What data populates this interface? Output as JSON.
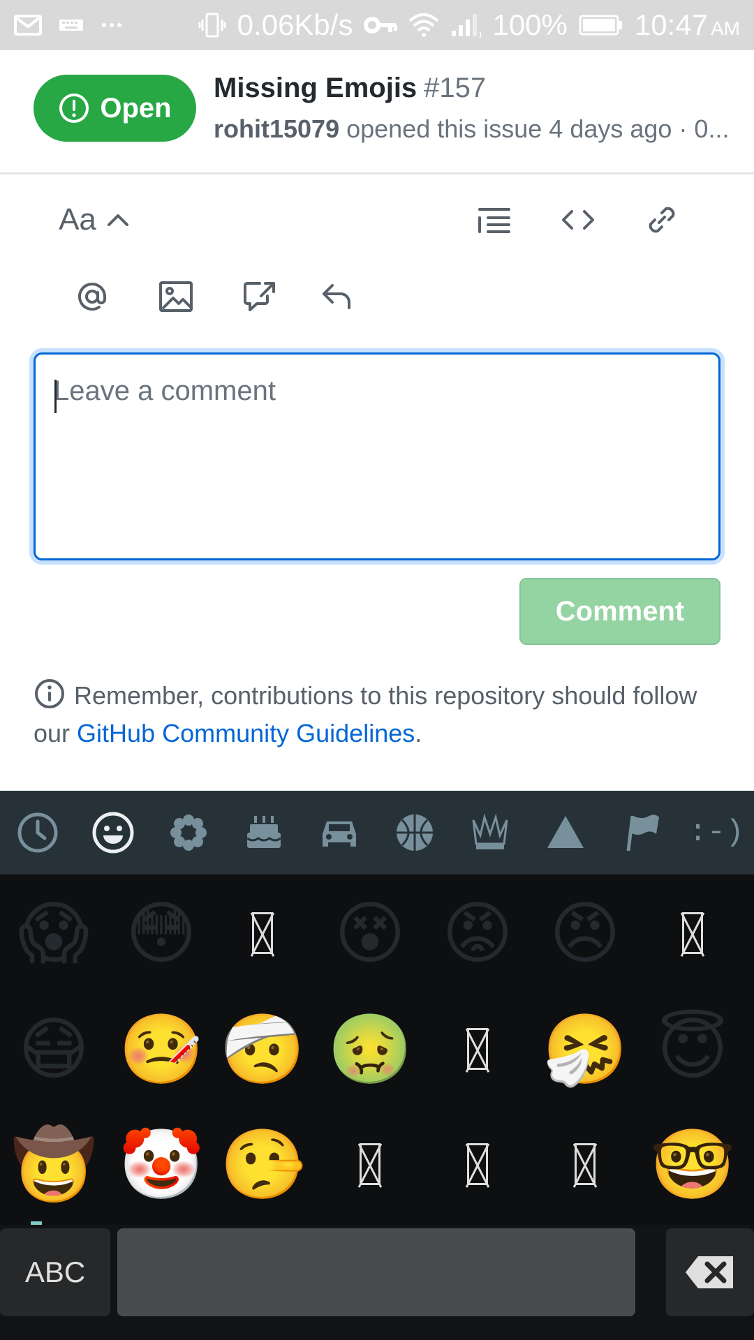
{
  "status_bar": {
    "network_speed": "0.06Kb/s",
    "battery": "100%",
    "time": "10:47",
    "ampm": "AM",
    "signal_sub": "1",
    "icons": [
      "gmail-icon",
      "keyboard-icon",
      "more-icon",
      "vibrate-icon",
      "vpn-key-icon",
      "wifi-icon",
      "signal-icon",
      "battery-icon"
    ]
  },
  "issue": {
    "state_label": "Open",
    "title": "Missing Emojis",
    "number": "#157",
    "author": "rohit15079",
    "meta_rest": " opened this issue 4 days ago · 0..."
  },
  "toolbar": {
    "text_style_label": "Aa",
    "icons_row1": [
      "chevron-up-icon",
      "list-icon",
      "code-icon",
      "link-icon"
    ],
    "icons_row2": [
      "mention-icon",
      "image-icon",
      "reference-icon",
      "reply-icon"
    ]
  },
  "comment": {
    "placeholder": "Leave a comment",
    "value": "",
    "button_label": "Comment"
  },
  "guidelines": {
    "text": "Remember, contributions to this repository should follow our ",
    "link": "GitHub Community Guidelines",
    "suffix": "."
  },
  "emoji_keyboard": {
    "tabs": [
      "recent-icon",
      "smileys-icon",
      "nature-icon",
      "food-icon",
      "travel-icon",
      "activity-icon",
      "objects-icon",
      "symbols-icon",
      "flags-icon",
      "emoticons-icon"
    ],
    "active_tab": "smileys-icon",
    "emoticon_tab_label": ":-)",
    "rows": [
      [
        "😱",
        "😳",
        "missing",
        "😵",
        "😡",
        "😠",
        "missing"
      ],
      [
        "😷",
        "🤒",
        "🤕",
        "🤢",
        "missing",
        "🤧",
        "😇"
      ],
      [
        "🤠",
        "🤡",
        "🤥",
        "missing",
        "missing",
        "missing",
        "🤓"
      ]
    ],
    "abc_label": "ABC",
    "delete_icon": "backspace-icon"
  },
  "colors": {
    "open_green": "#28a745",
    "link_blue": "#0366d6",
    "comment_button_disabled": "#94d3a2",
    "keyboard_tabs_bg": "#263238",
    "keyboard_bg": "#0e0f10"
  }
}
